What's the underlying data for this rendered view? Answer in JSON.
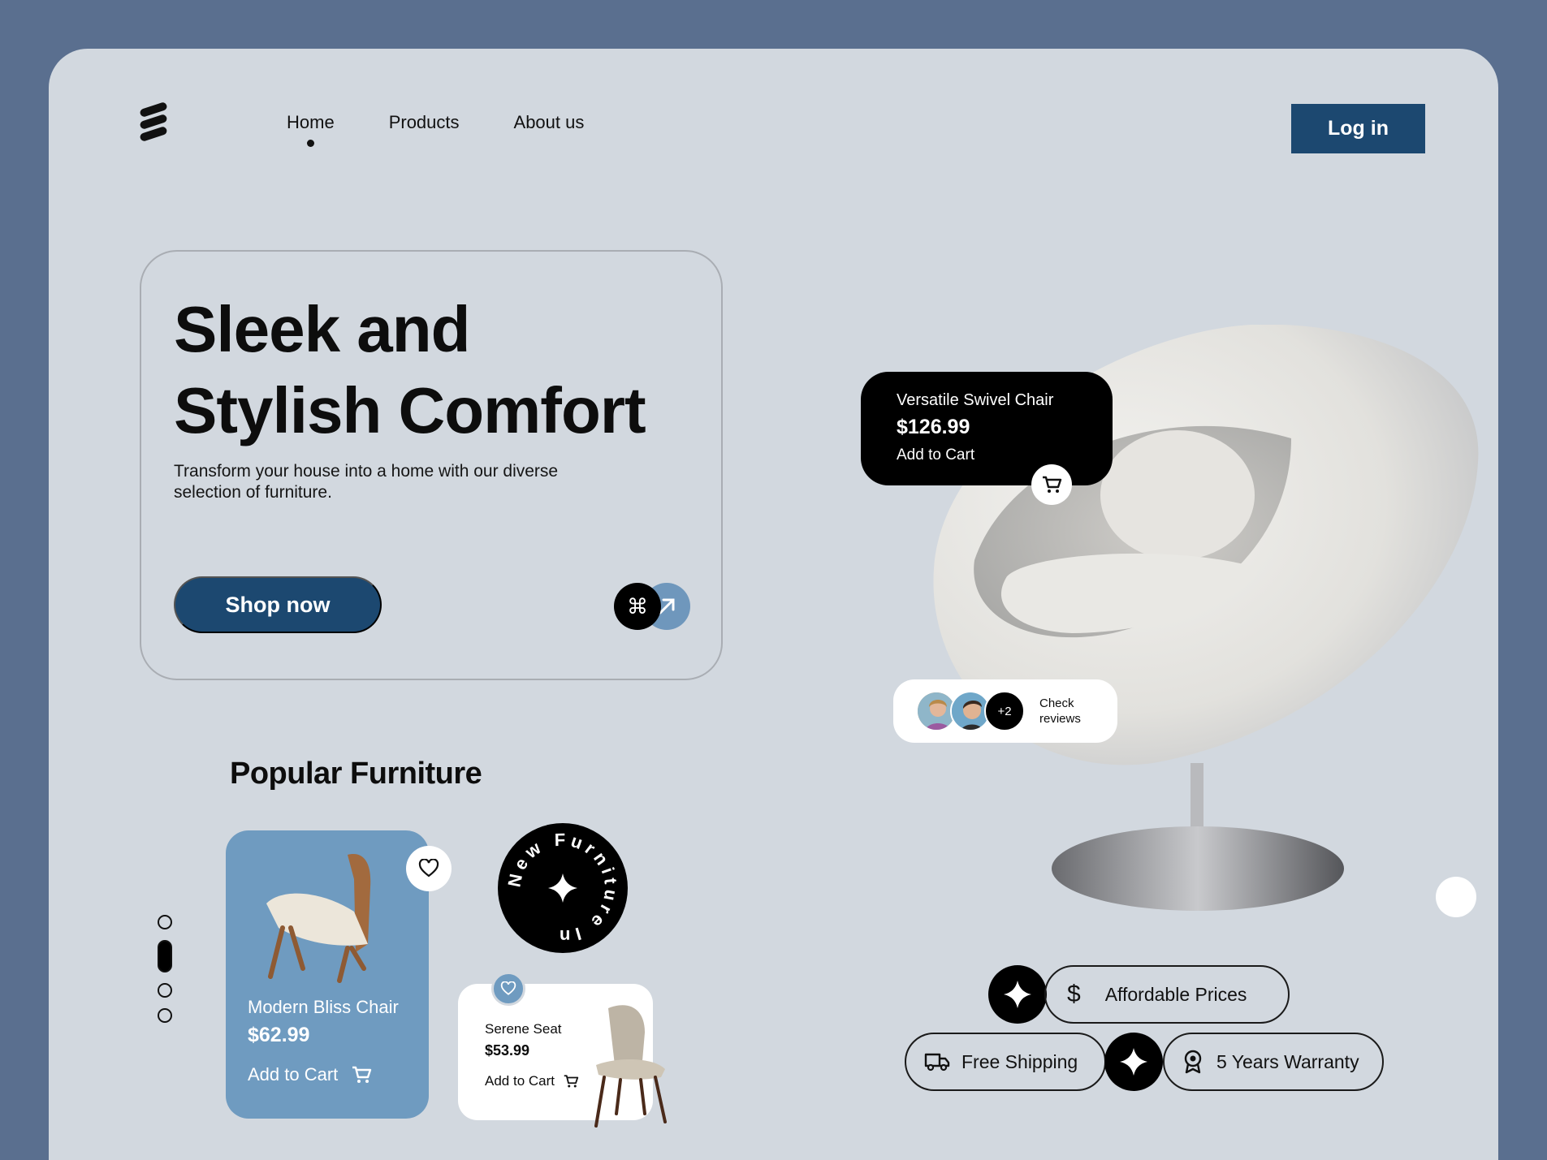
{
  "nav": {
    "items": [
      {
        "label": "Home",
        "active": true
      },
      {
        "label": "Products",
        "active": false
      },
      {
        "label": "About us",
        "active": false
      }
    ],
    "login_label": "Log in"
  },
  "hero": {
    "title": "Sleek and Stylish Comfort",
    "subtitle": "Transform your house into a home with our diverse selection of furniture.",
    "cta_label": "Shop now",
    "cmd_icon": "⌘"
  },
  "popular": {
    "title": "Popular Furniture",
    "pager": {
      "count": 4,
      "active_index": 1
    },
    "products": [
      {
        "name": "Modern Bliss Chair",
        "price": "$62.99",
        "cta": "Add to Cart"
      },
      {
        "name": "Serene Seat",
        "price": "$53.99",
        "cta": "Add to Cart"
      }
    ],
    "badge_text": "New Furniture In"
  },
  "featured": {
    "name": "Versatile Swivel Chair",
    "price": "$126.99",
    "cta": "Add to Cart"
  },
  "reviews": {
    "extra_count": "+2",
    "label": "Check reviews"
  },
  "features": [
    {
      "label": "Affordable Prices",
      "icon": "dollar-icon"
    },
    {
      "label": "Free Shipping",
      "icon": "truck-icon"
    },
    {
      "label": "5 Years Warranty",
      "icon": "award-icon"
    }
  ],
  "colors": {
    "background": "#5a6f8f",
    "frame": "#d2d8df",
    "primary": "#1c4870",
    "accent": "#6f9bc0"
  }
}
